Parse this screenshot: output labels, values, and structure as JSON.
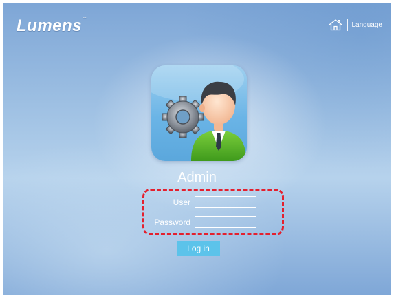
{
  "brand": {
    "name": "Lumens",
    "trademark": "™"
  },
  "topnav": {
    "home_icon": "home-icon",
    "language_label": "Language"
  },
  "login": {
    "title": "Admin",
    "avatar_icon": "admin-user-gear-icon",
    "user_label": "User",
    "user_value": "",
    "password_label": "Password",
    "password_value": "",
    "button_label": "Log in"
  },
  "colors": {
    "accent_button": "#5cc3ea",
    "highlight": "#e4202e",
    "background": "#9ec0e3"
  }
}
